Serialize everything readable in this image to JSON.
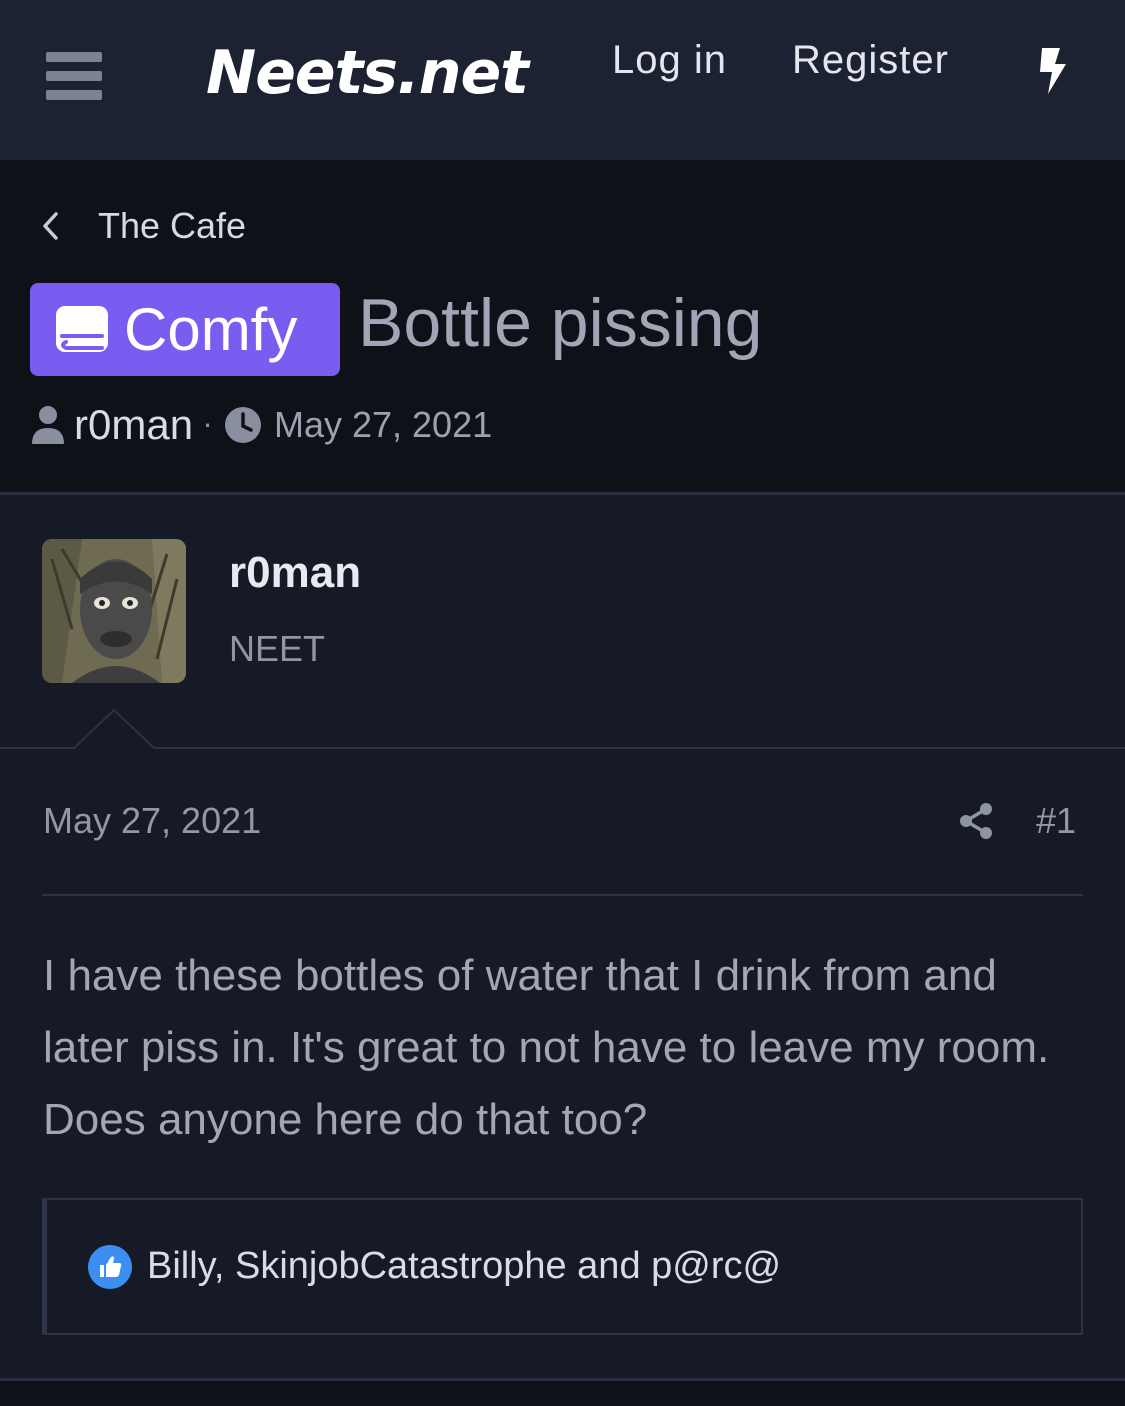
{
  "header": {
    "site_name": "Neets.net",
    "login_label": "Log in",
    "register_label": "Register",
    "menu_icon": "hamburger-menu-icon",
    "whats_new_icon": "lightning-bolt-icon"
  },
  "breadcrumb": {
    "label": "The Cafe",
    "icon": "chevron-left-icon"
  },
  "thread": {
    "prefix_label": "Comfy",
    "prefix_icon": "book-icon",
    "prefix_color": "#7a5cf0",
    "title": "Bottle pissing",
    "author": "r0man",
    "separator": "·",
    "date": "May 27, 2021"
  },
  "post": {
    "username": "r0man",
    "user_title": "NEET",
    "date": "May 27, 2021",
    "number": "#1",
    "share_icon": "share-icon",
    "text": "I have these bottles of water that I drink from and later piss in. It's great to not have to leave my room. Does anyone here do that too?",
    "reactions": {
      "icon": "like-thumbs-up-icon",
      "users_text": "Billy, SkinjobCatastrophe and p@rc@",
      "accent": "#3b8ff0"
    }
  }
}
